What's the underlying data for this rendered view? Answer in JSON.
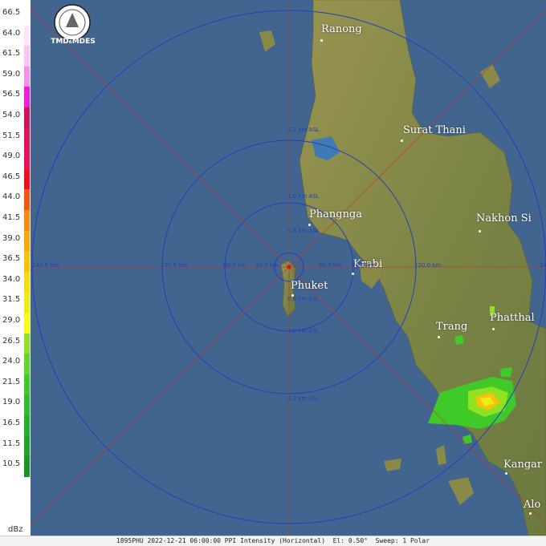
{
  "logo_text": "TMD₆MDES",
  "unit": "dBz",
  "scale": [
    {
      "label": "66.5",
      "color": "#ffffff"
    },
    {
      "label": "64.0",
      "color": "#fde3fb"
    },
    {
      "label": "61.5",
      "color": "#f7c6f2"
    },
    {
      "label": "59.0",
      "color": "#f58fe8"
    },
    {
      "label": "56.5",
      "color": "#f01ddf"
    },
    {
      "label": "54.0",
      "color": "#d2125e"
    },
    {
      "label": "51.5",
      "color": "#dd135c"
    },
    {
      "label": "49.0",
      "color": "#e81059"
    },
    {
      "label": "46.5",
      "color": "#ee0f1c"
    },
    {
      "label": "44.0",
      "color": "#f2560f"
    },
    {
      "label": "41.5",
      "color": "#f7890f"
    },
    {
      "label": "39.0",
      "color": "#f9a70f"
    },
    {
      "label": "36.5",
      "color": "#f8c00f"
    },
    {
      "label": "34.0",
      "color": "#f8dc12"
    },
    {
      "label": "31.5",
      "color": "#eced14"
    },
    {
      "label": "29.0",
      "color": "#f9fb14"
    },
    {
      "label": "26.5",
      "color": "#8fe222"
    },
    {
      "label": "24.0",
      "color": "#64d628"
    },
    {
      "label": "21.5",
      "color": "#3fca2a"
    },
    {
      "label": "19.0",
      "color": "#2fbd2f"
    },
    {
      "label": "16.5",
      "color": "#22b12b"
    },
    {
      "label": "11.5",
      "color": "#1ea32a"
    },
    {
      "label": "10.5",
      "color": "#1a9524"
    }
  ],
  "places": [
    {
      "name": "Ranong"
    },
    {
      "name": "Surat Thani"
    },
    {
      "name": "Phangnga"
    },
    {
      "name": "Nakhon Si"
    },
    {
      "name": "Krabi"
    },
    {
      "name": "Phuket"
    },
    {
      "name": "Trang"
    },
    {
      "name": "Phatthal"
    },
    {
      "name": "Kangar"
    },
    {
      "name": "Alo"
    }
  ],
  "range_labels": [
    "240.0 km",
    "120.0 km",
    "60.0 km",
    "30.0 km",
    "30.0 km",
    "60.0 km",
    "120.0 km",
    "24"
  ],
  "height_labels": [
    "2.2 km ASL",
    "1.0 km ASL",
    "0.8 km ASL",
    "0.8 km ASL",
    "1.0 km ASL",
    "2.2 km ASL"
  ],
  "footer": "1895PHU 2022-12-21 06:00:00 PPI Intensity (Horizontal)  El: 0.50°  Sweep: 1 Polar"
}
